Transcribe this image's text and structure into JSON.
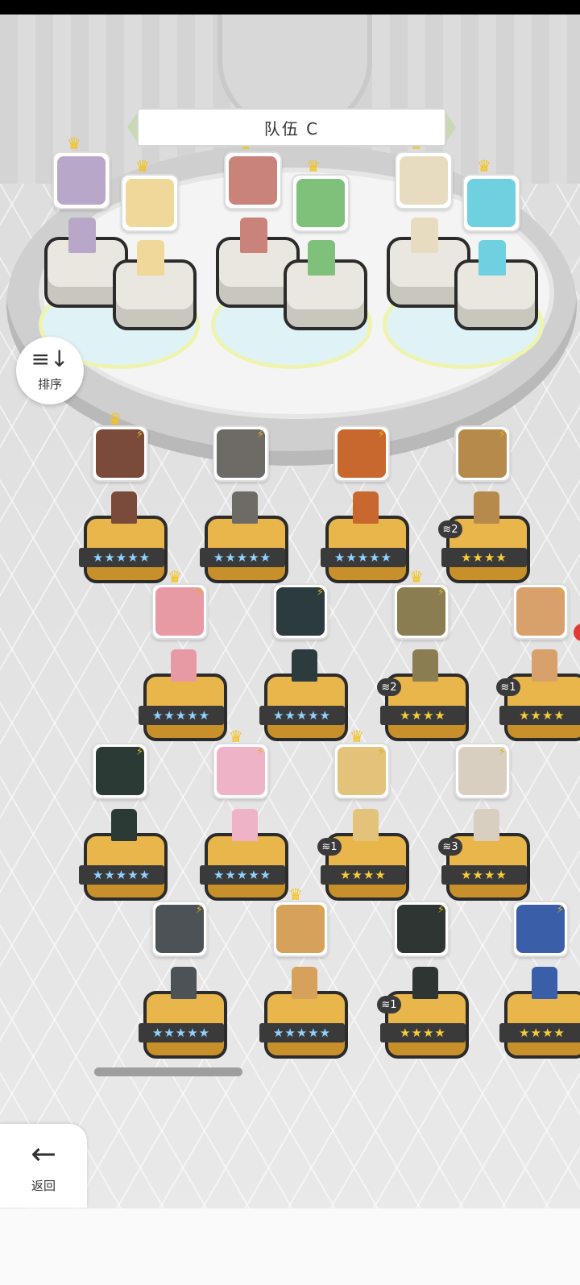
{
  "team": {
    "title": "队伍 C"
  },
  "sort": {
    "icon": "sort-icon",
    "label": "排序"
  },
  "back": {
    "icon": "back-arrow-icon",
    "label": "返回"
  },
  "lineup": [
    {
      "color": "#b9a7c9",
      "crown": "♛",
      "star": true
    },
    {
      "color": "#f0d79a",
      "crown": "♛"
    },
    {
      "color": "#c9837a",
      "crown": "♛"
    },
    {
      "color": "#7fc07a",
      "crown": "♛"
    },
    {
      "color": "#e8dcc0",
      "crown": "♛"
    },
    {
      "color": "#6fd1e0",
      "crown": "♛"
    }
  ],
  "heroes": [
    {
      "color": "#7a4b3a",
      "crown": "♛",
      "stars": "★★★★★",
      "blue": true
    },
    {
      "color": "#6e6a66",
      "stars": "★★★★★",
      "blue": true
    },
    {
      "color": "#c8682e",
      "stars": "★★★★★",
      "blue": true
    },
    {
      "color": "#b58a4a",
      "stars": "★★★★",
      "dup": "2"
    },
    {
      "color": "#e79aa4",
      "crown": "♛",
      "stars": "★★★★★",
      "blue": true
    },
    {
      "color": "#2c3b3e",
      "stars": "★★★★★",
      "blue": true
    },
    {
      "color": "#8a7d52",
      "crown": "♛",
      "stars": "★★★★",
      "dup": "2"
    },
    {
      "color": "#d8a06a",
      "stars": "★★★★",
      "dup": "1",
      "alert": "!"
    },
    {
      "color": "#2b3a35",
      "stars": "★★★★★",
      "blue": true
    },
    {
      "color": "#efb3c8",
      "crown": "♛",
      "stars": "★★★★★",
      "blue": true
    },
    {
      "color": "#e3c27a",
      "crown": "♛",
      "stars": "★★★★",
      "dup": "1"
    },
    {
      "color": "#d9cfc0",
      "stars": "★★★★",
      "dup": "3"
    },
    {
      "color": "#4d5256",
      "stars": "★★★★★",
      "blue": true
    },
    {
      "color": "#d6a15a",
      "crown": "♛",
      "stars": "★★★★★",
      "blue": true
    },
    {
      "color": "#2e3532",
      "stars": "★★★★",
      "dup": "1"
    },
    {
      "color": "#3a5ea8",
      "stars": "★★★★"
    }
  ]
}
